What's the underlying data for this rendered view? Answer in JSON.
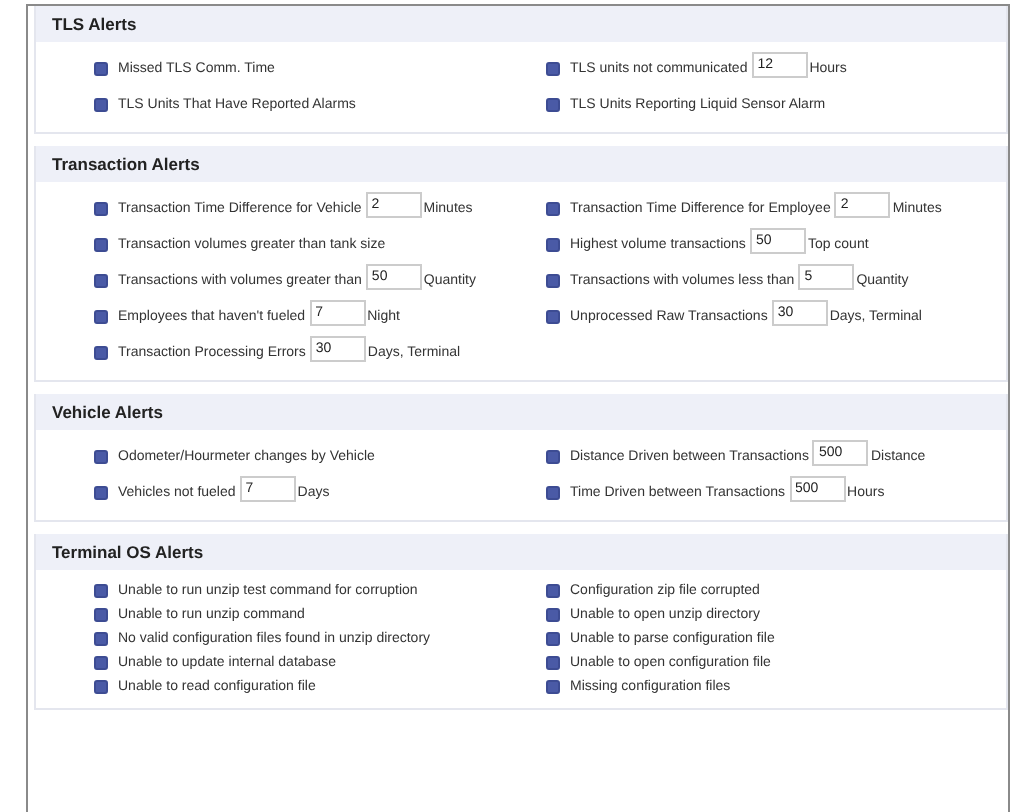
{
  "sections": [
    {
      "title": "TLS Alerts",
      "items": [
        {
          "label": "Missed TLS Comm. Time",
          "checked": true
        },
        {
          "label": "TLS units not communicated",
          "checked": true,
          "value": "12",
          "unit": "Hours"
        },
        {
          "label": "TLS Units That Have Reported Alarms",
          "checked": true
        },
        {
          "label": "TLS Units Reporting Liquid Sensor Alarm",
          "checked": true
        }
      ]
    },
    {
      "title": "Transaction Alerts",
      "items": [
        {
          "label": "Transaction Time Difference for Vehicle",
          "checked": true,
          "value": "2",
          "unit": "Minutes"
        },
        {
          "label": "Transaction Time Difference for Employee",
          "checked": true,
          "value": "2",
          "unit": "Minutes"
        },
        {
          "label": "Transaction volumes greater than tank size",
          "checked": true
        },
        {
          "label": "Highest volume transactions",
          "checked": true,
          "value": "50",
          "unit": "Top count"
        },
        {
          "label": "Transactions with volumes greater than",
          "checked": true,
          "value": "50",
          "unit": "Quantity"
        },
        {
          "label": "Transactions with volumes less than",
          "checked": true,
          "value": "5",
          "unit": "Quantity"
        },
        {
          "label": "Employees that haven't fueled",
          "checked": true,
          "value": "7",
          "unit": "Night"
        },
        {
          "label": "Unprocessed Raw Transactions",
          "checked": true,
          "value": "30",
          "unit": "Days, Terminal"
        },
        {
          "label": "Transaction Processing Errors",
          "checked": true,
          "value": "30",
          "unit": "Days, Terminal"
        }
      ]
    },
    {
      "title": "Vehicle Alerts",
      "items": [
        {
          "label": "Odometer/Hourmeter changes by Vehicle",
          "checked": true
        },
        {
          "label": "Distance Driven between Transactions",
          "checked": true,
          "value": "500",
          "unit": "Distance"
        },
        {
          "label": "Vehicles not fueled",
          "checked": true,
          "value": "7",
          "unit": "Days"
        },
        {
          "label": "Time Driven between Transactions",
          "checked": true,
          "value": "500",
          "unit": "Hours"
        }
      ]
    },
    {
      "title": "Terminal OS Alerts",
      "items": [
        {
          "label": "Unable to run unzip test command for corruption",
          "checked": true
        },
        {
          "label": "Configuration zip file corrupted",
          "checked": true
        },
        {
          "label": "Unable to run unzip command",
          "checked": true
        },
        {
          "label": "Unable to open unzip directory",
          "checked": true
        },
        {
          "label": "No valid configuration files found in unzip directory",
          "checked": true
        },
        {
          "label": "Unable to parse configuration file",
          "checked": true
        },
        {
          "label": "Unable to update internal database",
          "checked": true
        },
        {
          "label": "Unable to open configuration file",
          "checked": true
        },
        {
          "label": "Unable to read configuration file",
          "checked": true
        },
        {
          "label": "Missing configuration files",
          "checked": true
        }
      ]
    }
  ]
}
